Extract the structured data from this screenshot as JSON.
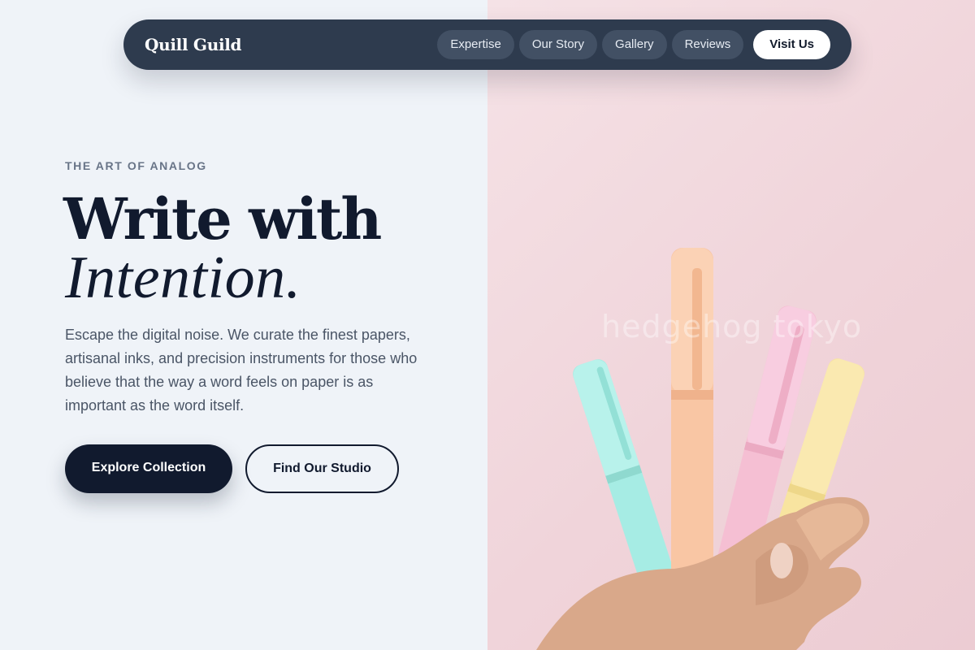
{
  "nav": {
    "brand": "Quill Guild",
    "links": [
      "Expertise",
      "Our Story",
      "Gallery",
      "Reviews"
    ],
    "cta": "Visit Us"
  },
  "hero": {
    "eyebrow": "THE ART OF ANALOG",
    "headline_line1": "Write with",
    "headline_line2": "Intention.",
    "description": "Escape the digital noise. We curate the finest papers, artisanal inks, and precision instruments for those who believe that the way a word feels on paper is as important as the word itself.",
    "primary_button": "Explore Collection",
    "secondary_button": "Find Our Studio"
  },
  "image": {
    "watermark": "hedgehog tokyo"
  },
  "colors": {
    "nav_bg": "#2e3b4e",
    "pill_bg": "#425064",
    "ink": "#111a2e",
    "page_bg": "#eff3f8",
    "photo_bg": "#f0d4da",
    "marker_mint": "#a6ece4",
    "marker_peach": "#f9c6a4",
    "marker_pink": "#f5bfd3",
    "marker_yellow": "#f8e4a0"
  }
}
